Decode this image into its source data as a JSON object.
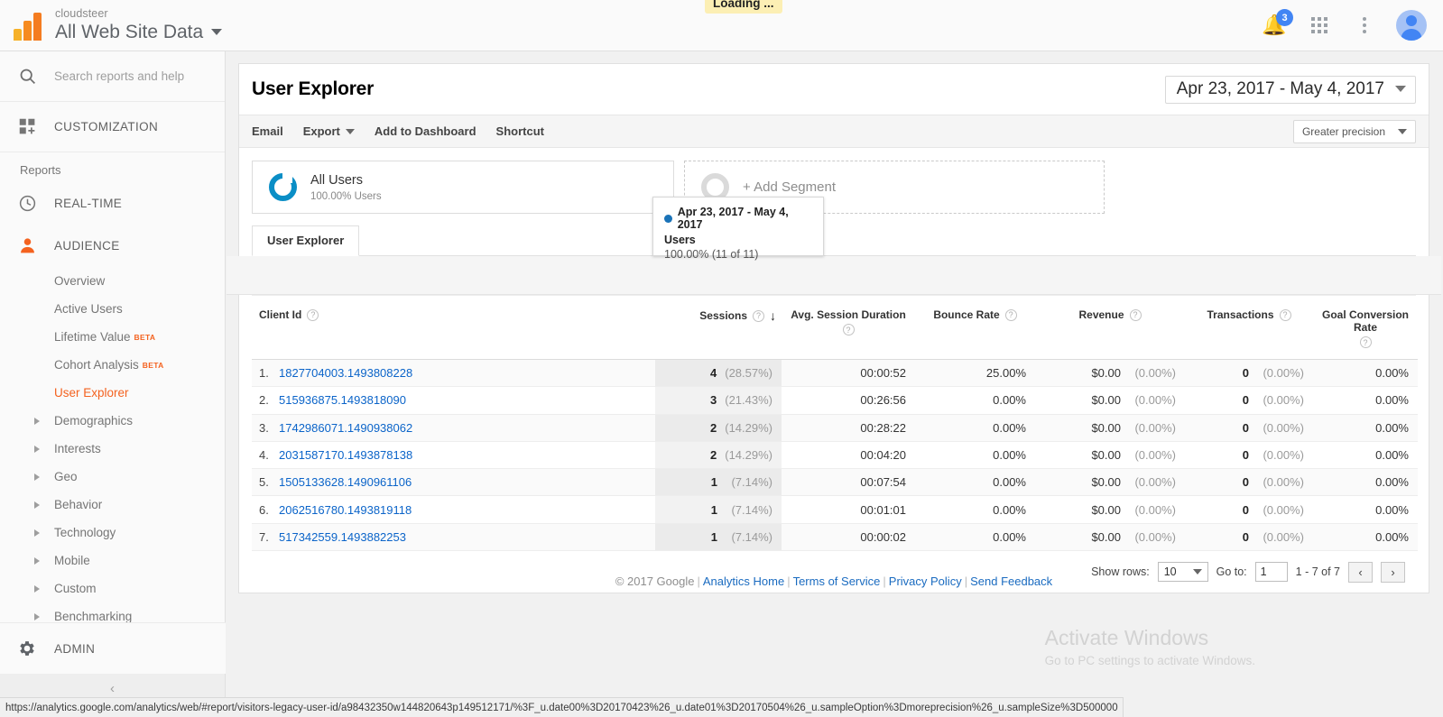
{
  "topbar": {
    "account_name": "cloudsteer",
    "property_name": "All Web Site Data",
    "notification_count": "3",
    "loading_badge": "Loading ..."
  },
  "sidebar": {
    "search_placeholder": "Search reports and help",
    "customization_label": "CUSTOMIZATION",
    "reports_label": "Reports",
    "realtime_label": "REAL-TIME",
    "audience_label": "AUDIENCE",
    "admin_label": "ADMIN",
    "sub_items": [
      {
        "label": "Overview",
        "beta": "",
        "group": false
      },
      {
        "label": "Active Users",
        "beta": "",
        "group": false
      },
      {
        "label": "Lifetime Value",
        "beta": "BETA",
        "group": false
      },
      {
        "label": "Cohort Analysis",
        "beta": "BETA",
        "group": false
      },
      {
        "label": "User Explorer",
        "beta": "",
        "group": false,
        "active": true
      },
      {
        "label": "Demographics",
        "beta": "",
        "group": true
      },
      {
        "label": "Interests",
        "beta": "",
        "group": true
      },
      {
        "label": "Geo",
        "beta": "",
        "group": true
      },
      {
        "label": "Behavior",
        "beta": "",
        "group": true
      },
      {
        "label": "Technology",
        "beta": "",
        "group": true
      },
      {
        "label": "Mobile",
        "beta": "",
        "group": true
      },
      {
        "label": "Custom",
        "beta": "",
        "group": true
      },
      {
        "label": "Benchmarking",
        "beta": "",
        "group": true
      }
    ]
  },
  "report": {
    "title": "User Explorer",
    "date_range": "Apr 23, 2017 - May 4, 2017",
    "precision_label": "Greater precision",
    "toolbar": {
      "email": "Email",
      "export": "Export",
      "add_to_dashboard": "Add to Dashboard",
      "shortcut": "Shortcut"
    },
    "segments": {
      "all_users_name": "All Users",
      "all_users_sub": "100.00% Users",
      "add_segment_label": "+ Add Segment"
    },
    "tab_label": "User Explorer",
    "tooltip": {
      "range": "Apr 23, 2017 - May 4, 2017",
      "metric": "Users",
      "value": "100.00% (11 of 11)"
    }
  },
  "table": {
    "headers": {
      "client_id": "Client Id",
      "sessions": "Sessions",
      "avg_session_duration": "Avg. Session Duration",
      "bounce_rate": "Bounce Rate",
      "revenue": "Revenue",
      "transactions": "Transactions",
      "goal_conversion_rate": "Goal Conversion Rate"
    },
    "rows": [
      {
        "index": "1.",
        "client_id": "1827704003.1493808228",
        "sessions": "4",
        "sessions_pct": "(28.57%)",
        "avg_session_duration": "00:00:52",
        "bounce_rate": "25.00%",
        "revenue": "$0.00",
        "revenue_pct": "(0.00%)",
        "transactions": "0",
        "transactions_pct": "(0.00%)",
        "goal_conversion_rate": "0.00%"
      },
      {
        "index": "2.",
        "client_id": "515936875.1493818090",
        "sessions": "3",
        "sessions_pct": "(21.43%)",
        "avg_session_duration": "00:26:56",
        "bounce_rate": "0.00%",
        "revenue": "$0.00",
        "revenue_pct": "(0.00%)",
        "transactions": "0",
        "transactions_pct": "(0.00%)",
        "goal_conversion_rate": "0.00%"
      },
      {
        "index": "3.",
        "client_id": "1742986071.1490938062",
        "sessions": "2",
        "sessions_pct": "(14.29%)",
        "avg_session_duration": "00:28:22",
        "bounce_rate": "0.00%",
        "revenue": "$0.00",
        "revenue_pct": "(0.00%)",
        "transactions": "0",
        "transactions_pct": "(0.00%)",
        "goal_conversion_rate": "0.00%"
      },
      {
        "index": "4.",
        "client_id": "2031587170.1493878138",
        "sessions": "2",
        "sessions_pct": "(14.29%)",
        "avg_session_duration": "00:04:20",
        "bounce_rate": "0.00%",
        "revenue": "$0.00",
        "revenue_pct": "(0.00%)",
        "transactions": "0",
        "transactions_pct": "(0.00%)",
        "goal_conversion_rate": "0.00%"
      },
      {
        "index": "5.",
        "client_id": "1505133628.1490961106",
        "sessions": "1",
        "sessions_pct": "(7.14%)",
        "avg_session_duration": "00:07:54",
        "bounce_rate": "0.00%",
        "revenue": "$0.00",
        "revenue_pct": "(0.00%)",
        "transactions": "0",
        "transactions_pct": "(0.00%)",
        "goal_conversion_rate": "0.00%"
      },
      {
        "index": "6.",
        "client_id": "2062516780.1493819118",
        "sessions": "1",
        "sessions_pct": "(7.14%)",
        "avg_session_duration": "00:01:01",
        "bounce_rate": "0.00%",
        "revenue": "$0.00",
        "revenue_pct": "(0.00%)",
        "transactions": "0",
        "transactions_pct": "(0.00%)",
        "goal_conversion_rate": "0.00%"
      },
      {
        "index": "7.",
        "client_id": "517342559.1493882253",
        "sessions": "1",
        "sessions_pct": "(7.14%)",
        "avg_session_duration": "00:00:02",
        "bounce_rate": "0.00%",
        "revenue": "$0.00",
        "revenue_pct": "(0.00%)",
        "transactions": "0",
        "transactions_pct": "(0.00%)",
        "goal_conversion_rate": "0.00%"
      }
    ]
  },
  "pager": {
    "show_rows_label": "Show rows:",
    "rows_value": "10",
    "go_to_label": "Go to:",
    "page_value": "1",
    "range_label": "1 - 7 of 7",
    "prev_icon": "‹",
    "next_icon": "›"
  },
  "footer": {
    "copyright": "© 2017 Google",
    "links": [
      "Analytics Home",
      "Terms of Service",
      "Privacy Policy",
      "Send Feedback"
    ]
  },
  "watermark": {
    "line1": "Activate Windows",
    "line2": "Go to PC settings to activate Windows."
  },
  "statusbar": {
    "url": "https://analytics.google.com/analytics/web/#report/visitors-legacy-user-id/a98432350w144820643p149512171/%3F_u.date00%3D20170423%26_u.date01%3D20170504%26_u.sampleOption%3Dmoreprecision%26_u.sampleSize%3D500000"
  }
}
